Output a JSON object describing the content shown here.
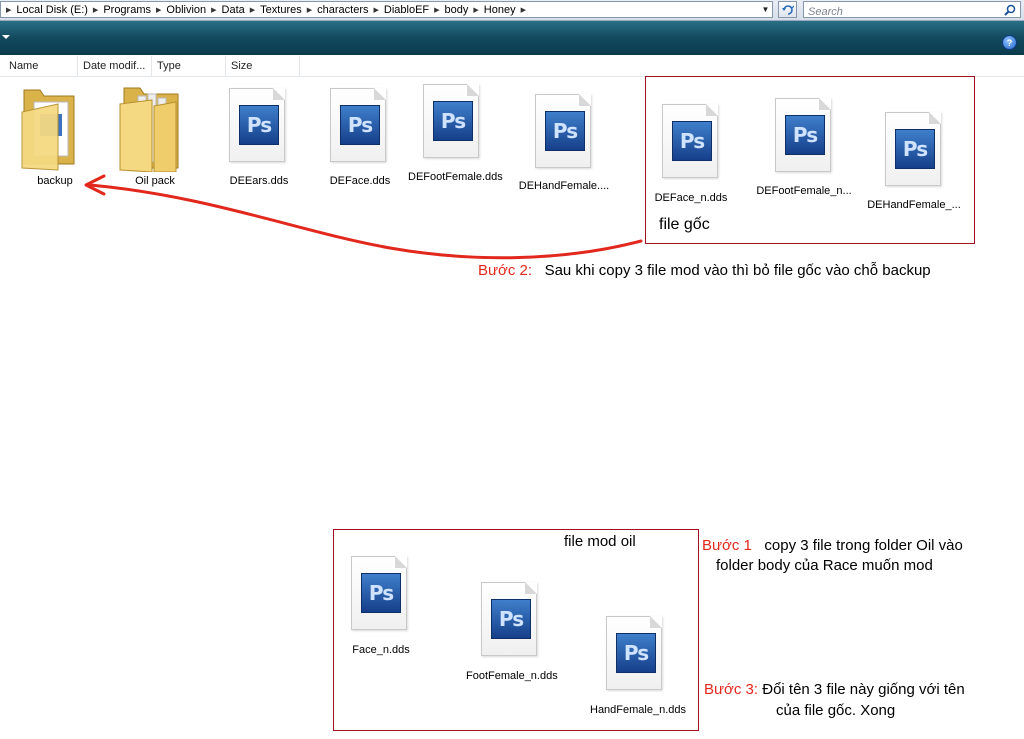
{
  "address_bar": {
    "crumbs": [
      "Local Disk (E:)",
      "Programs",
      "Oblivion",
      "Data",
      "Textures",
      "characters",
      "DiabloEF",
      "body",
      "Honey"
    ],
    "search_placeholder": "Search"
  },
  "columns": {
    "name": "Name",
    "date_modified": "Date modif...",
    "type": "Type",
    "size": "Size"
  },
  "top_files": [
    {
      "name": "backup",
      "kind": "folder"
    },
    {
      "name": "Oil pack",
      "kind": "folder"
    },
    {
      "name": "DEEars.dds",
      "kind": "psd-icon"
    },
    {
      "name": "DEFace.dds",
      "kind": "psd-icon"
    },
    {
      "name": "DEFootFemale.dds",
      "kind": "psd-icon"
    },
    {
      "name": "DEHandFemale....",
      "kind": "psd-icon"
    }
  ],
  "original_files": {
    "label": "file gốc",
    "items": [
      "DEFace_n.dds",
      "DEFootFemale_n...",
      "DEHandFemale_..."
    ]
  },
  "mod_files": {
    "label": "file mod oil",
    "items": [
      "Face_n.dds",
      "FootFemale_n.dds",
      "HandFemale_n.dds"
    ]
  },
  "icon_text": "Ps",
  "notes": {
    "step2": {
      "label": "Bước 2:",
      "text": "Sau khi copy 3 file mod vào thì bỏ file gốc vào chỗ backup"
    },
    "step1": {
      "label": "Bước 1",
      "line1": "copy 3 file trong folder Oil vào",
      "line2": "folder body của Race muốn mod"
    },
    "step3": {
      "label": "Bước 3:",
      "line1": "Đổi tên 3 file này giống với tên",
      "line2": "của file gốc. Xong"
    }
  },
  "colors": {
    "annotation_red": "#e2281d",
    "box_border": "#a01020",
    "toolbar": "#12495e"
  }
}
